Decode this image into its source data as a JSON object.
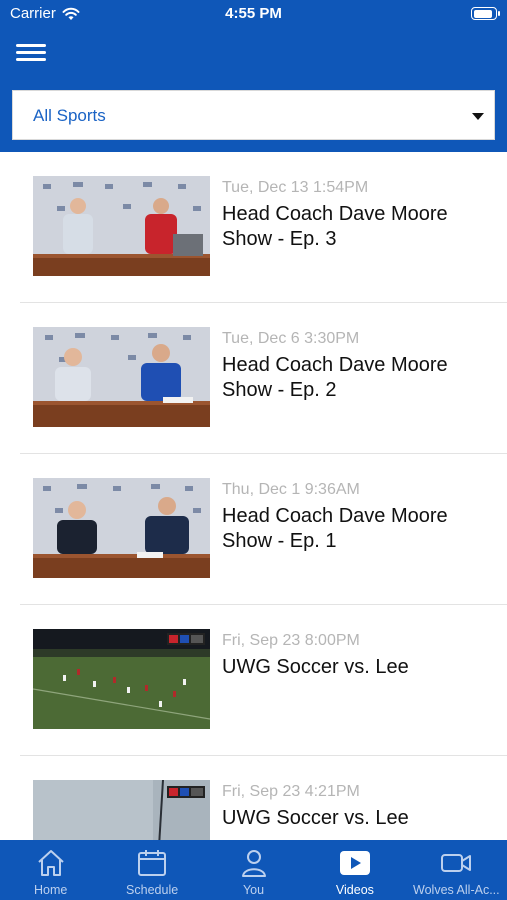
{
  "status_bar": {
    "carrier": "Carrier",
    "time": "4:55 PM",
    "battery_level": 0.9
  },
  "filter": {
    "selected": "All Sports"
  },
  "videos": [
    {
      "date": "Tue, Dec 13 1:54PM",
      "title": "Head Coach Dave Moore Show - Ep. 3",
      "thumbnail": "press-conference-thumbnail"
    },
    {
      "date": "Tue, Dec 6 3:30PM",
      "title": "Head Coach Dave Moore Show - Ep. 2",
      "thumbnail": "press-conference-thumbnail"
    },
    {
      "date": "Thu, Dec 1 9:36AM",
      "title": "Head Coach Dave Moore Show - Ep. 1",
      "thumbnail": "press-conference-thumbnail"
    },
    {
      "date": "Fri, Sep 23 8:00PM",
      "title": "UWG Soccer vs. Lee",
      "thumbnail": "soccer-field-thumbnail"
    },
    {
      "date": "Fri, Sep 23 4:21PM",
      "title": "UWG Soccer vs. Lee",
      "thumbnail": "soccer-field-thumbnail"
    }
  ],
  "tabs": [
    {
      "label": "Home",
      "icon": "home-icon"
    },
    {
      "label": "Schedule",
      "icon": "calendar-icon"
    },
    {
      "label": "You",
      "icon": "person-icon"
    },
    {
      "label": "Videos",
      "icon": "play-icon"
    },
    {
      "label": "Wolves All-Ac...",
      "icon": "video-camera-icon"
    }
  ],
  "colors": {
    "brand": "#0f57b8",
    "link": "#1a63c5",
    "date": "#b5b5b5"
  }
}
